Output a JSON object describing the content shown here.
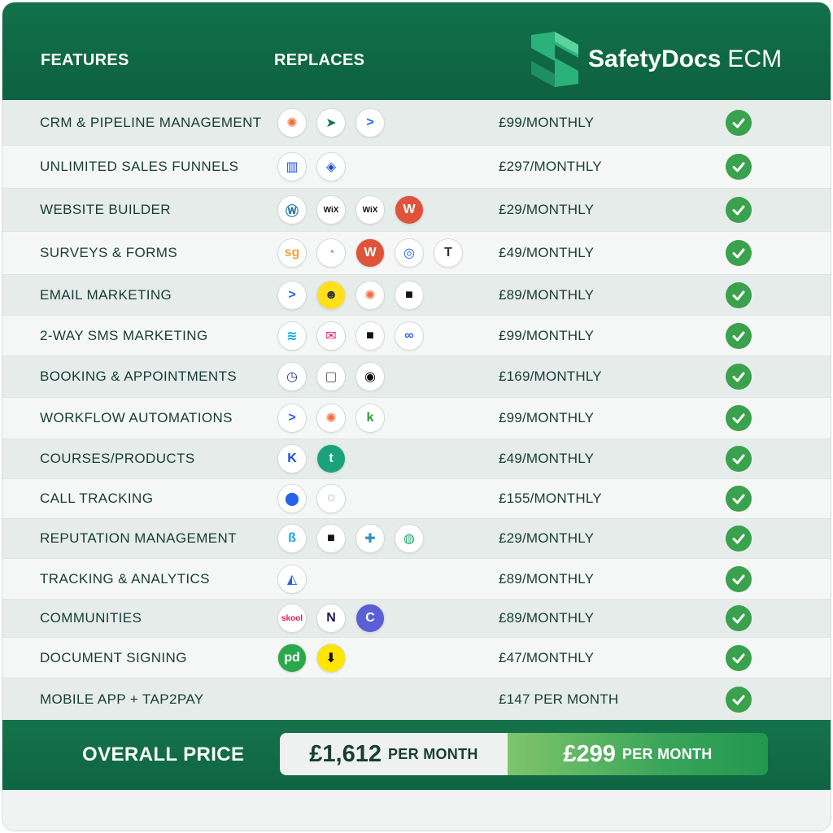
{
  "header": {
    "features_label": "FEATURES",
    "replaces_label": "REPLACES",
    "brand_name": "SafetyDocs",
    "brand_suffix": "ECM"
  },
  "rows": [
    {
      "feature": "CRM & PIPELINE MANAGEMENT",
      "price": "£99/MONTHLY",
      "icons": [
        "hubspot-icon",
        "pipedrive-icon",
        "activecampaign-icon"
      ]
    },
    {
      "feature": "UNLIMITED SALES FUNNELS",
      "price": "£297/MONTHLY",
      "icons": [
        "clickfunnels-icon",
        "leadpages-icon"
      ]
    },
    {
      "feature": "WEBSITE BUILDER",
      "price": "£29/MONTHLY",
      "icons": [
        "wordpress-icon",
        "wix-icon",
        "wix-icon",
        "webflow-icon"
      ]
    },
    {
      "feature": "SURVEYS & FORMS",
      "price": "£49/MONTHLY",
      "icons": [
        "surveygizmo-icon",
        "typeform-icon",
        "wufoo-icon",
        "jotform-icon",
        "typeform-t-icon"
      ]
    },
    {
      "feature": "EMAIL MARKETING",
      "price": "£89/MONTHLY",
      "icons": [
        "activecampaign-icon",
        "mailchimp-icon",
        "hubspot-icon",
        "chat-bubble-icon"
      ]
    },
    {
      "feature": "2-WAY SMS MARKETING",
      "price": "£99/MONTHLY",
      "icons": [
        "stack-icon",
        "envelope-icon",
        "chat-bubble-icon",
        "link-icon"
      ]
    },
    {
      "feature": "BOOKING & APPOINTMENTS",
      "price": "£169/MONTHLY",
      "icons": [
        "calendly-icon",
        "calendar-icon",
        "acuity-icon"
      ]
    },
    {
      "feature": "WORKFLOW AUTOMATIONS",
      "price": "£99/MONTHLY",
      "icons": [
        "activecampaign-icon",
        "hubspot-icon",
        "keap-icon"
      ]
    },
    {
      "feature": "COURSES/PRODUCTS",
      "price": "£49/MONTHLY",
      "icons": [
        "kajabi-icon",
        "teachable-icon"
      ]
    },
    {
      "feature": "CALL TRACKING",
      "price": "£155/MONTHLY",
      "icons": [
        "location-pin-icon",
        "callrail-icon"
      ]
    },
    {
      "feature": "REPUTATION MANAGEMENT",
      "price": "£29/MONTHLY",
      "icons": [
        "birdeye-icon",
        "chat-bubble-icon",
        "puzzle-icon",
        "podium-icon"
      ]
    },
    {
      "feature": "TRACKING & ANALYTICS",
      "price": "£89/MONTHLY",
      "icons": [
        "analytics-icon"
      ]
    },
    {
      "feature": "COMMUNITIES",
      "price": "£89/MONTHLY",
      "icons": [
        "skool-icon",
        "mighty-networks-icon",
        "circle-icon"
      ]
    },
    {
      "feature": "DOCUMENT SIGNING",
      "price": "£47/MONTHLY",
      "icons": [
        "pandadoc-icon",
        "docusign-icon"
      ]
    },
    {
      "feature": "MOBILE APP + TAP2PAY",
      "price": "£147 PER MONTH",
      "icons": []
    }
  ],
  "footer": {
    "overall_label": "OVERALL PRICE",
    "old_amount": "£1,612",
    "old_per": "PER MONTH",
    "new_amount": "£299",
    "new_per": "PER MONTH"
  },
  "colors": {
    "header_green": "#12714a",
    "check_green": "#3aa14c",
    "text_dark": "#173d35"
  }
}
